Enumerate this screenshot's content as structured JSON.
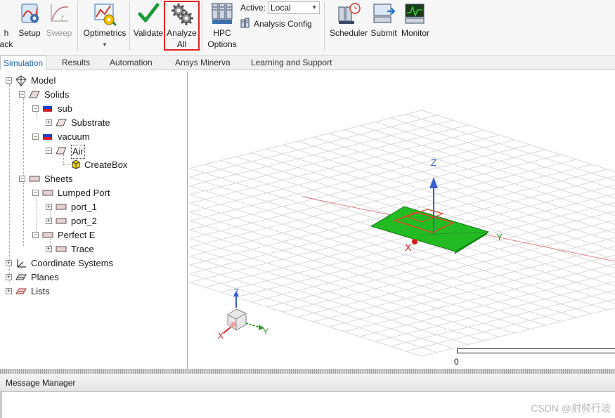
{
  "ribbon": {
    "launch_label_1": "h",
    "launch_label_2": "ack",
    "setup_label": "Setup",
    "sweep_label": "Sweep",
    "optimetrics_label": "Optimetrics",
    "validate_label": "Validate",
    "analyze_label_1": "Analyze",
    "analyze_label_2": "All",
    "hpc_label_1": "HPC",
    "hpc_label_2": "Options",
    "active_label": "Active:",
    "active_value": "Local",
    "analysis_config_label": "Analysis Config",
    "scheduler_label": "Scheduler",
    "submit_label": "Submit",
    "monitor_label": "Monitor",
    "highlight_color": "#e3231f"
  },
  "tabs": [
    "Simulation",
    "Results",
    "Automation",
    "Ansys Minerva",
    "Learning and Support"
  ],
  "tree": {
    "model": "Model",
    "solids": "Solids",
    "sub": "sub",
    "substrate": "Substrate",
    "vacuum": "vacuum",
    "air": "Air",
    "createbox": "CreateBox",
    "sheets": "Sheets",
    "lumped_port": "Lumped Port",
    "port_1": "port_1",
    "port_2": "port_2",
    "perfect_e": "Perfect E",
    "trace": "Trace",
    "coordinate_systems": "Coordinate Systems",
    "planes": "Planes",
    "lists": "Lists"
  },
  "viewport": {
    "axis_z": "Z",
    "axis_y": "Y",
    "axis_x": "X",
    "triad_z": "Z",
    "triad_y": "Y",
    "triad_x": "X",
    "scale_zero": "0",
    "board_color": "#22bb22",
    "trace_color": "#d84a2a"
  },
  "message_manager": {
    "title": "Message Manager"
  },
  "watermark": "CSDN @射频行波"
}
